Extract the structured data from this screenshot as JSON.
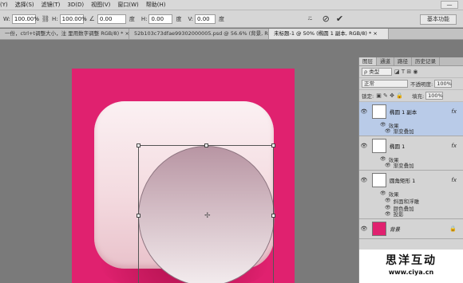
{
  "menu": [
    "(Y)",
    "选择(S)",
    "滤镜(T)",
    "3D(D)",
    "视图(V)",
    "窗口(W)",
    "帮助(H)"
  ],
  "window_ctrl": "—",
  "options": {
    "w_label": "W:",
    "w_value": "100.00%",
    "link_icon": "⛓",
    "h_label": "H:",
    "h_value": "100.00%",
    "angle_icon": "∠",
    "angle_value": "0.00",
    "angle_unit": "度",
    "hskew_label": "H:",
    "hskew_value": "0.00",
    "hskew_unit": "度",
    "vskew_label": "V:",
    "vskew_value": "0.00",
    "vskew_unit": "度",
    "warp_icon": "⍨",
    "cancel_icon": "⊘",
    "commit_icon": "✔",
    "workspace": "基本功能"
  },
  "tabs": [
    "一份，ctrl+t调整大小，注 里用数字调整  RGB/8) * ×",
    "52b103c73dfae99302000005.psd @ 56.6% (背景, RGB/8) * ×",
    "未标题-1 @ 50% (椭圆 1 副本, RGB/8) * ×"
  ],
  "panel": {
    "tabs": [
      "图层",
      "通道",
      "路径",
      "历史记录"
    ],
    "kind_label": "ρ 类型",
    "filter_icons": "◪ T ⊞ ◉",
    "blend_mode": "正常",
    "opacity_label": "不透明度:",
    "opacity_value": "100%",
    "lock_label": "锁定:",
    "lock_icons": "▣ ✎ ✥ 🔒",
    "fill_label": "填充:",
    "fill_value": "100%",
    "eye_icon": "👁",
    "fx": "fx",
    "lock_icon": "🔒",
    "effects_label": "效果",
    "layers": [
      {
        "name": "椭圆 1 副本",
        "effects": [
          "渐变叠加"
        ]
      },
      {
        "name": "椭圆 1",
        "effects": [
          "渐变叠加"
        ]
      },
      {
        "name": "圆角矩形 1",
        "effects": [
          "斜面和浮雕",
          "颜色叠加",
          "投影"
        ]
      },
      {
        "name": "背景"
      }
    ]
  },
  "watermark": {
    "title": "思洋互动",
    "url": "www.ciya.cn"
  },
  "colors": {
    "canvas_bg": "#e0216f",
    "selected_layer": "#b9cbe8"
  }
}
